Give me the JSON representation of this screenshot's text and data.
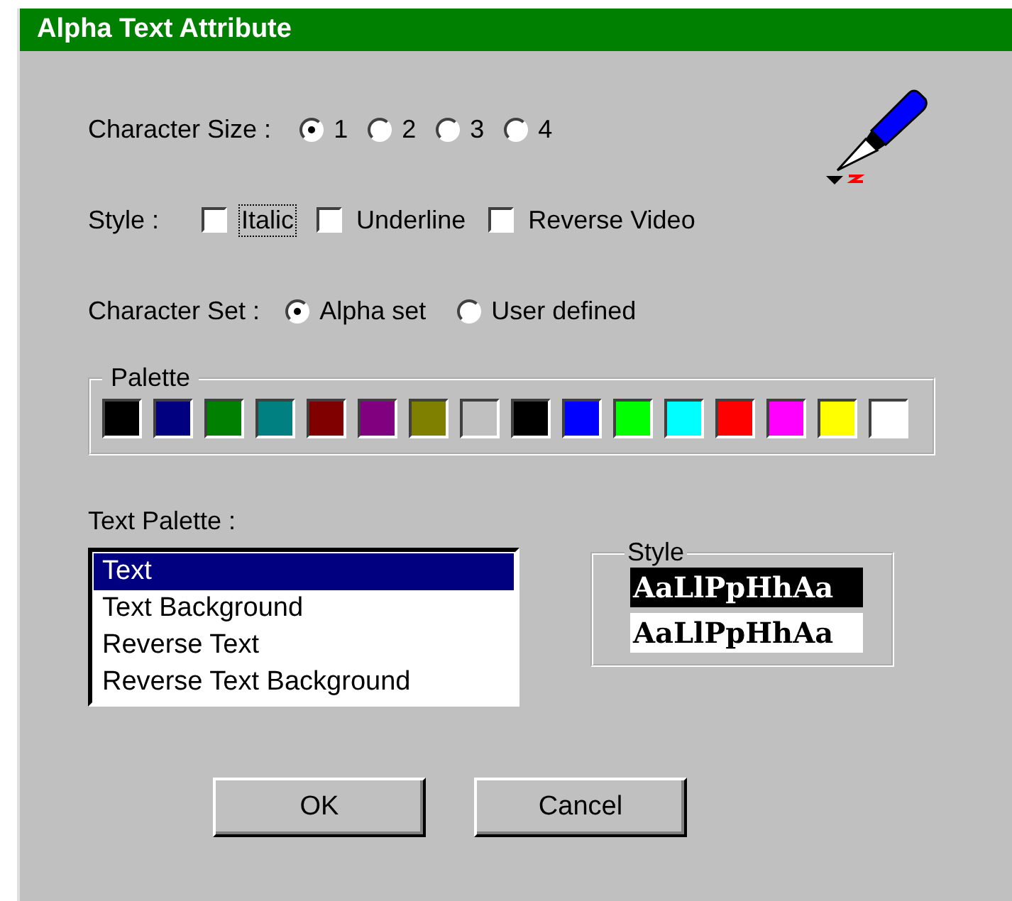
{
  "window": {
    "title": "Alpha Text Attribute"
  },
  "character_size": {
    "label": "Character Size :",
    "options": [
      {
        "label": "1",
        "selected": true
      },
      {
        "label": "2",
        "selected": false
      },
      {
        "label": "3",
        "selected": false
      },
      {
        "label": "4",
        "selected": false
      }
    ]
  },
  "style": {
    "label": "Style :",
    "options": [
      {
        "label": "Italic",
        "checked": false,
        "focused": true
      },
      {
        "label": "Underline",
        "checked": false,
        "focused": false
      },
      {
        "label": "Reverse Video",
        "checked": false,
        "focused": false
      }
    ]
  },
  "character_set": {
    "label": "Character Set :",
    "options": [
      {
        "label": "Alpha set",
        "selected": true
      },
      {
        "label": "User defined",
        "selected": false
      }
    ]
  },
  "palette": {
    "title": "Palette",
    "swatches": [
      {
        "color": "#000000"
      },
      {
        "color": "#000080"
      },
      {
        "color": "#008000"
      },
      {
        "color": "#008080"
      },
      {
        "color": "#800000"
      },
      {
        "color": "#800080"
      },
      {
        "color": "#808000"
      },
      {
        "color": "#c0c0c0"
      },
      {
        "color": "#000000"
      },
      {
        "color": "#0000ff"
      },
      {
        "color": "#00ff00"
      },
      {
        "color": "#00ffff"
      },
      {
        "color": "#ff0000"
      },
      {
        "color": "#ff00ff"
      },
      {
        "color": "#ffff00"
      },
      {
        "color": "#ffffff"
      }
    ]
  },
  "text_palette": {
    "label": "Text Palette :",
    "items": [
      {
        "label": "Text",
        "selected": true
      },
      {
        "label": "Text Background",
        "selected": false
      },
      {
        "label": "Reverse Text",
        "selected": false
      },
      {
        "label": "Reverse Text Background",
        "selected": false
      }
    ]
  },
  "style_preview": {
    "title": "Style",
    "samples": [
      {
        "text": "AaLlPpHhAa",
        "kind": "reverse"
      },
      {
        "text": "AaLlPpHhAa",
        "kind": "normal"
      }
    ]
  },
  "buttons": [
    {
      "label": "OK"
    },
    {
      "label": "Cancel"
    }
  ]
}
